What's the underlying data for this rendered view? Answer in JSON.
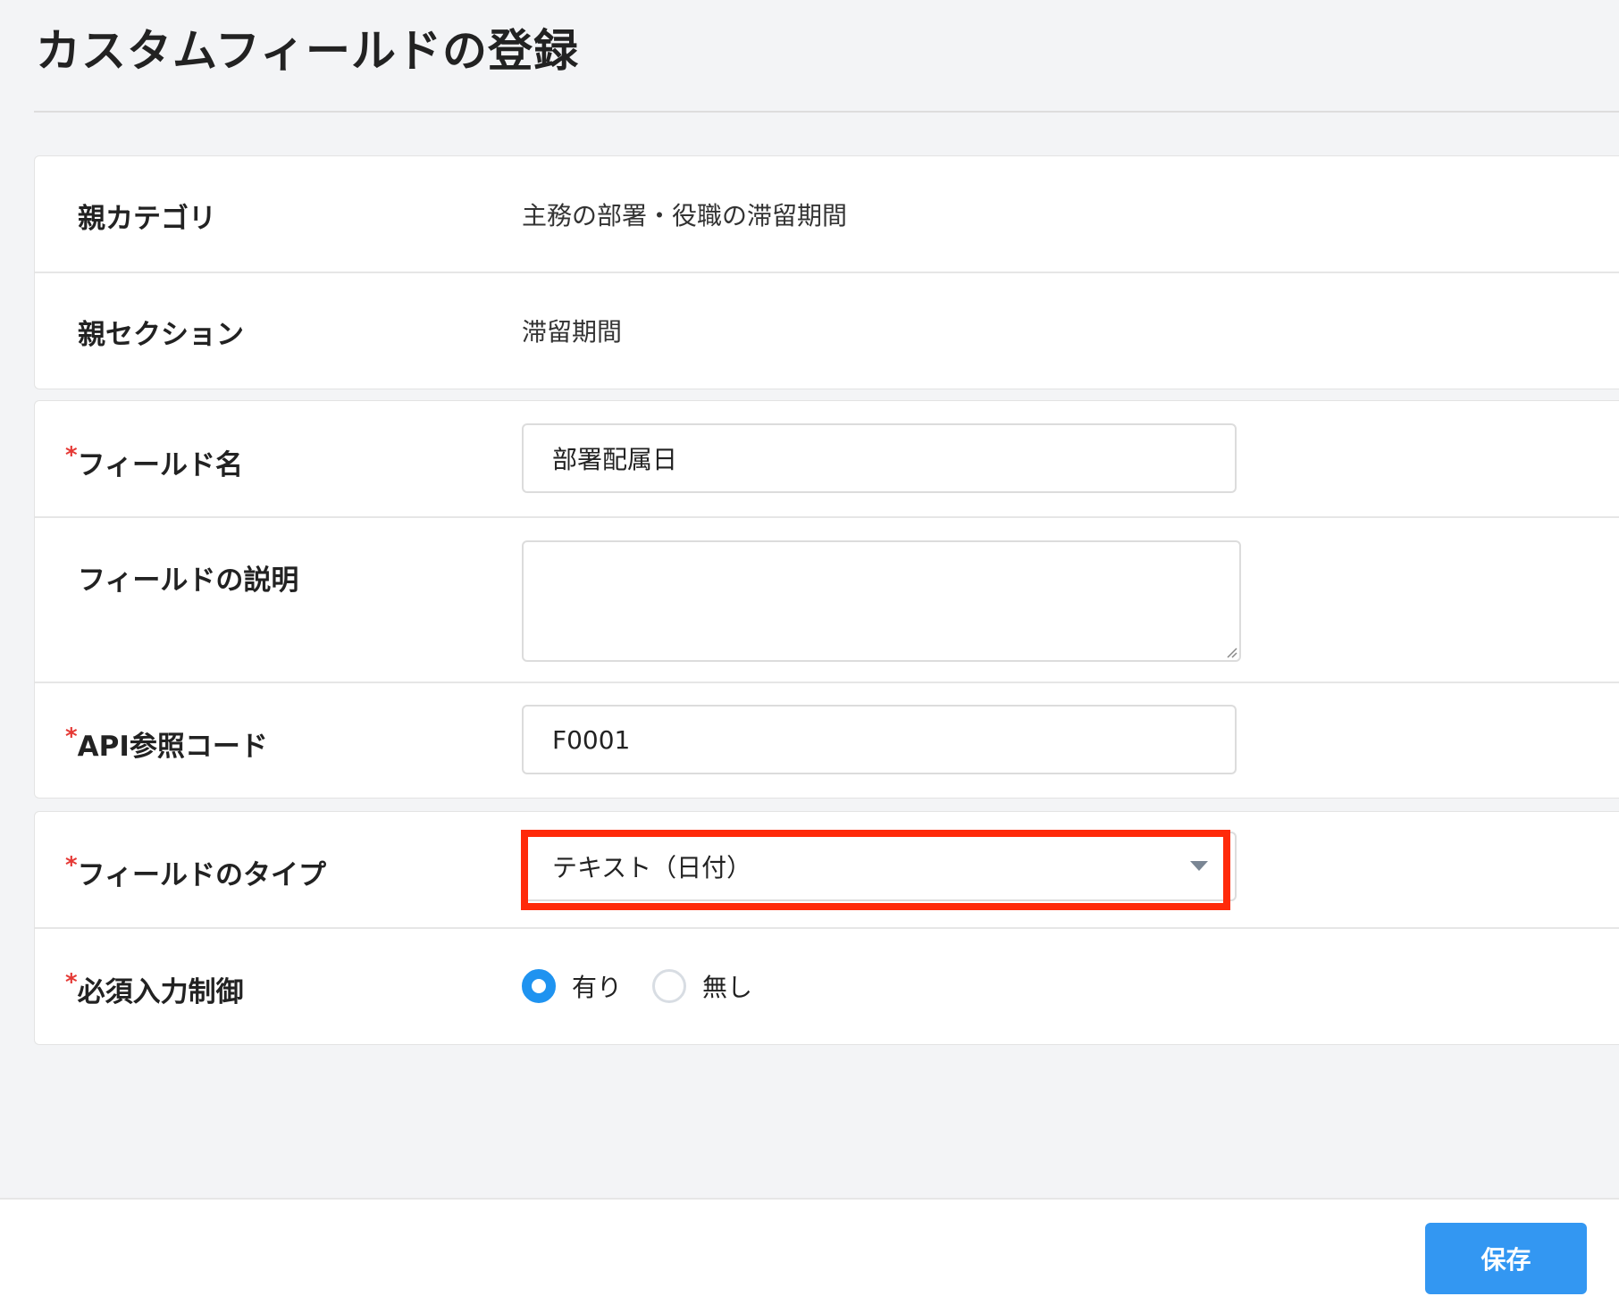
{
  "page": {
    "title": "カスタムフィールドの登録"
  },
  "info": {
    "parent_category_label": "親カテゴリ",
    "parent_category_value": "主務の部署・役職の滞留期間",
    "parent_section_label": "親セクション",
    "parent_section_value": "滞留期間"
  },
  "form": {
    "required_mark": "*",
    "field_name_label": "フィールド名",
    "field_name_value": "部署配属日",
    "field_description_label": "フィールドの説明",
    "field_description_value": "",
    "api_code_label": "API参照コード",
    "api_code_value": "F0001",
    "field_type_label": "フィールドのタイプ",
    "field_type_selected": "テキスト（日付）",
    "required_control_label": "必須入力制御",
    "required_options": [
      {
        "label": "有り",
        "selected": true
      },
      {
        "label": "無し",
        "selected": false
      }
    ]
  },
  "footer": {
    "save_label": "保存"
  },
  "colors": {
    "accent": "#3397f2",
    "radio_on": "#1f93f0",
    "required_mark": "#e53935",
    "highlight": "#ff2a0a"
  }
}
